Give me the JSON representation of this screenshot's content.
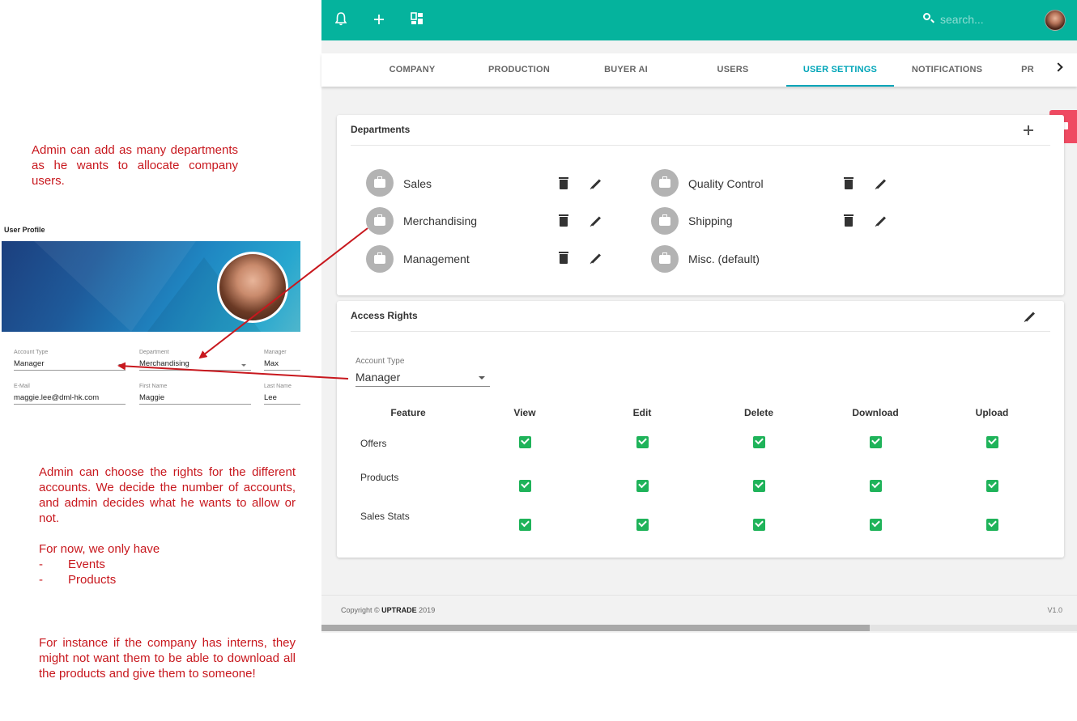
{
  "annotations": {
    "note1": "Admin can add as many departments as he wants to allocate company users.",
    "note2_p1": "Admin can choose the rights for the different accounts. We decide the number of accounts, and admin decides what he wants to allow or not.",
    "note2_p2": "For now, we only have",
    "note2_items": [
      "Events",
      "Products"
    ],
    "note2_dash": "-",
    "note3": "For instance if the company has interns, they might not want them to be able to download all the products and give them to someone!",
    "color": "#c8181e"
  },
  "user_profile": {
    "title": "User Profile",
    "fields": {
      "account_type_label": "Account Type",
      "account_type_value": "Manager",
      "department_label": "Department",
      "department_value": "Merchandising",
      "manager_label": "Manager",
      "manager_value": "Max",
      "email_label": "E-Mail",
      "email_value": "maggie.lee@dml-hk.com",
      "first_name_label": "First Name",
      "first_name_value": "Maggie",
      "last_name_label": "Last Name",
      "last_name_value": "Lee"
    }
  },
  "topbar": {
    "color": "#05b39d",
    "icons": [
      "bell-icon",
      "plus-icon",
      "dashboard-icon"
    ],
    "search_placeholder": "search..."
  },
  "tabs": {
    "items": [
      "COMPANY",
      "PRODUCTION",
      "BUYER AI",
      "USERS",
      "USER SETTINGS",
      "NOTIFICATIONS",
      "PR"
    ],
    "active": "USER SETTINGS",
    "accent": "#00a5b8"
  },
  "departments": {
    "title": "Departments",
    "left": [
      "Sales",
      "Merchandising",
      "Management"
    ],
    "right": [
      "Quality Control",
      "Shipping",
      "Misc. (default)"
    ]
  },
  "access_rights": {
    "title": "Access Rights",
    "account_type_label": "Account Type",
    "account_type_value": "Manager",
    "headers": [
      "Feature",
      "View",
      "Edit",
      "Delete",
      "Download",
      "Upload"
    ],
    "rows": [
      {
        "feature": "Offers",
        "view": true,
        "edit": true,
        "delete": true,
        "download": true,
        "upload": true
      },
      {
        "feature": "Products",
        "view": true,
        "edit": true,
        "delete": true,
        "download": true,
        "upload": true
      },
      {
        "feature": "Sales Stats",
        "view": true,
        "edit": true,
        "delete": true,
        "download": true,
        "upload": true
      }
    ],
    "check_color": "#1fb35a"
  },
  "footer": {
    "copyright_prefix": "Copyright © ",
    "brand": "UPTRADE",
    "year": " 2019",
    "version": "V1.0"
  }
}
